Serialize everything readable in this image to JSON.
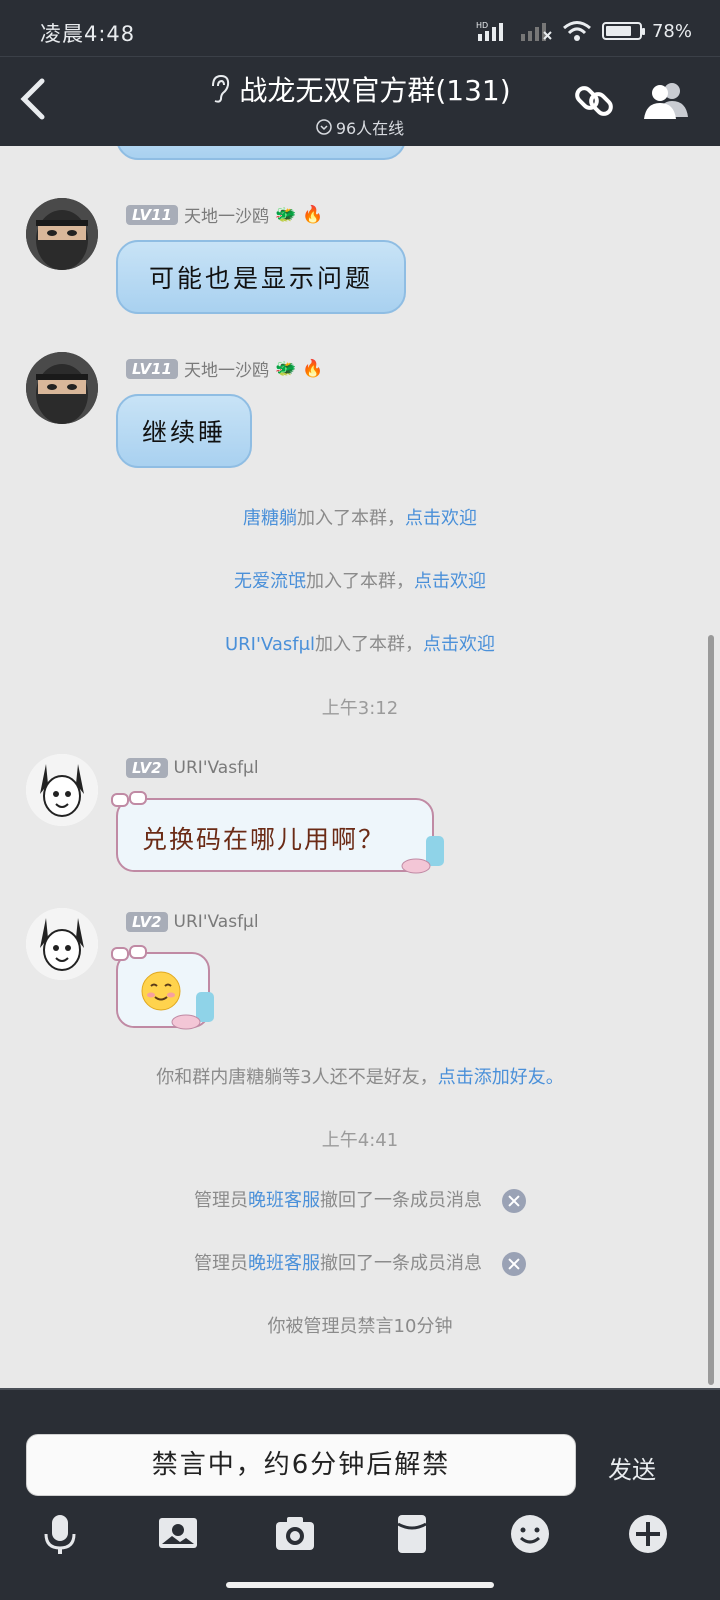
{
  "status_bar": {
    "time": "凌晨4:48",
    "battery": "78%",
    "battery_level": 0.78,
    "net_label": "HD"
  },
  "header": {
    "title": "战龙无双官方群(131)",
    "online": "96人在线"
  },
  "messages": [
    {
      "level": "LV11",
      "name": "天地一沙鸥",
      "text": "可能也是显示问题"
    },
    {
      "level": "LV11",
      "name": "天地一沙鸥",
      "text": "继续睡"
    }
  ],
  "joins": [
    {
      "name": "唐糖躺",
      "action": "加入了本群，",
      "link": "点击欢迎"
    },
    {
      "name": "无爱流氓",
      "action": "加入了本群，",
      "link": "点击欢迎"
    },
    {
      "name": "URI'Vasfμl",
      "action": "加入了本群，",
      "link": "点击欢迎"
    }
  ],
  "time1": "上午3:12",
  "messages2": [
    {
      "level": "LV2",
      "name": "URI'Vasfμl",
      "text": "兑换码在哪儿用啊？"
    },
    {
      "level": "LV2",
      "name": "URI'Vasfμl",
      "text": ""
    }
  ],
  "friend_notice": {
    "text": "你和群内唐糖躺等3人还不是好友，",
    "link": "点击添加好友。"
  },
  "time2": "上午4:41",
  "recalls": [
    {
      "pre": "管理员",
      "admin": "晚班客服",
      "post": "撤回了一条成员消息"
    },
    {
      "pre": "管理员",
      "admin": "晚班客服",
      "post": "撤回了一条成员消息"
    }
  ],
  "mute_notice": "你被管理员禁言10分钟",
  "input": {
    "placeholder": "禁言中，约6分钟后解禁",
    "send": "发送"
  },
  "toolbar_icons": [
    "microphone-icon",
    "image-icon",
    "camera-icon",
    "red-packet-icon",
    "emoji-icon",
    "plus-icon"
  ]
}
